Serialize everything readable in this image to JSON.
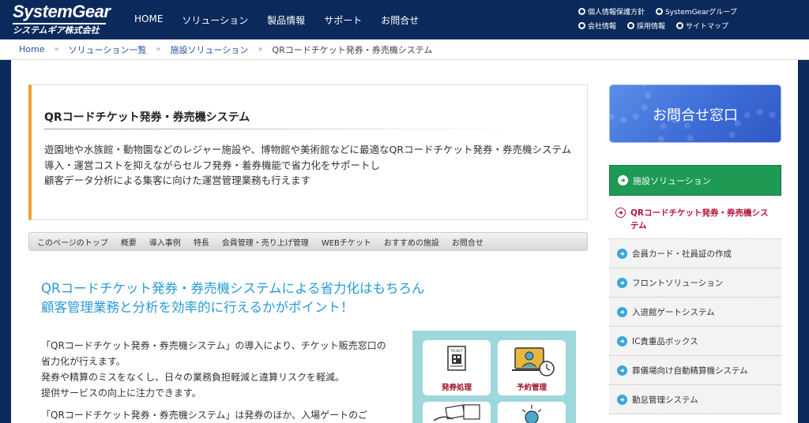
{
  "header": {
    "logo_main": "SystemGear",
    "logo_sub": "システムギア株式会社",
    "nav": [
      "HOME",
      "ソリューション",
      "製品情報",
      "サポート",
      "お問合せ"
    ],
    "util_row1": [
      "個人情報保護方針",
      "SystemGearグループ"
    ],
    "util_row2": [
      "会社情報",
      "採用情報",
      "サイトマップ"
    ]
  },
  "breadcrumb": {
    "items": [
      "Home",
      "ソリューション一覧",
      "施設ソリューション"
    ],
    "separator": "»",
    "current": "QRコードチケット発券・券売機システム"
  },
  "intro": {
    "title": "QRコードチケット発券・券売機システム",
    "lines": [
      "遊園地や水族館・動物園などのレジャー施設や、博物館や美術館などに最適なQRコードチケット発券・券売機システム",
      "導入・運営コストを抑えながらセルフ発券・着券機能で省力化をサポートし",
      "顧客データ分析による集客に向けた運営管理業務も行えます"
    ]
  },
  "page_nav": [
    "このページのトップ",
    "概要",
    "導入事例",
    "特長",
    "会員管理・売り上げ管理",
    "WEBチケット",
    "おすすめの施設",
    "お問合せ"
  ],
  "lead": {
    "line1": "QRコードチケット発券・券売機システムによる省力化はもちろん",
    "line2": "顧客管理業務と分析を効率的に行えるかがポイント！"
  },
  "body": {
    "para1": [
      "「QRコードチケット発券・券売機システム」の導入により、チケット販売窓口の省力化が行えます。",
      "発券や精算のミスをなくし、日々の業務負担軽減と違算リスクを軽減。",
      "提供サービスの向上に注力できます。"
    ],
    "para2": "「QRコードチケット発券・券売機システム」は発券のほか、入場ゲートのご"
  },
  "illustration": {
    "card1_label": "発券処理",
    "card2_label": "予約管理",
    "ticket_text": "TICKET"
  },
  "sidebar": {
    "contact_label": "お問合せ窓口",
    "header": "施設ソリューション",
    "active": "QRコードチケット発券・券売機システム",
    "items": [
      "会員カード・社員証の作成",
      "フロントソリューション",
      "入退館ゲートシステム",
      "IC貴重品ボックス",
      "葬儀場向け自動精算機システム",
      "勤怠管理システム"
    ]
  },
  "colors": {
    "header_bg": "#0b2a5b",
    "accent_orange": "#f0a030",
    "lead_blue": "#2a9bd8",
    "sidebar_green": "#1e9a55",
    "active_red": "#b0163c",
    "illus_bg": "#9fd8dc"
  }
}
